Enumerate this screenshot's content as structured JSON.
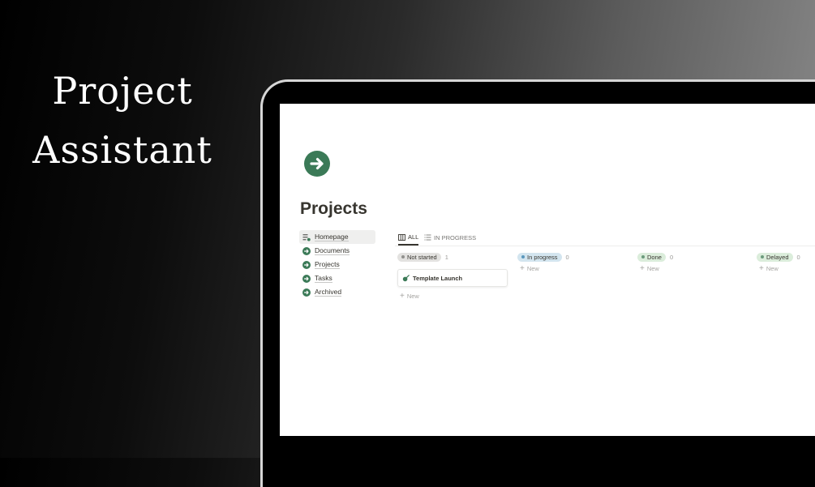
{
  "hero": {
    "line1": "Project",
    "line2": "Assistant"
  },
  "page": {
    "title": "Projects",
    "icon": "arrow-right-circle-icon",
    "accent": "#3b7a57"
  },
  "sidebar": {
    "items": [
      {
        "label": "Homepage",
        "icon": "database-icon"
      },
      {
        "label": "Documents",
        "icon": "arrow-right-circle-icon"
      },
      {
        "label": "Projects",
        "icon": "arrow-right-circle-icon"
      },
      {
        "label": "Tasks",
        "icon": "arrow-right-circle-icon"
      },
      {
        "label": "Archived",
        "icon": "arrow-right-circle-icon"
      }
    ]
  },
  "views": {
    "tabs": [
      {
        "label": "ALL",
        "icon": "board-icon"
      },
      {
        "label": "IN PROGRESS",
        "icon": "list-icon"
      }
    ]
  },
  "board": {
    "new_label": "New",
    "columns": [
      {
        "status": "Not started",
        "count": "1",
        "pill_bg": "#e3e2e0",
        "dot": "#91918e",
        "cards": [
          {
            "title": "Template Launch",
            "icon": "rocket-icon"
          }
        ]
      },
      {
        "status": "In progress",
        "count": "0",
        "pill_bg": "#d3e5ef",
        "dot": "#5b97bd",
        "cards": []
      },
      {
        "status": "Done",
        "count": "0",
        "pill_bg": "#dbeddb",
        "dot": "#6c9b7d",
        "cards": []
      },
      {
        "status": "Delayed",
        "count": "0",
        "pill_bg": "#dbeddb",
        "dot": "#6c9b7d",
        "cards": []
      }
    ]
  }
}
